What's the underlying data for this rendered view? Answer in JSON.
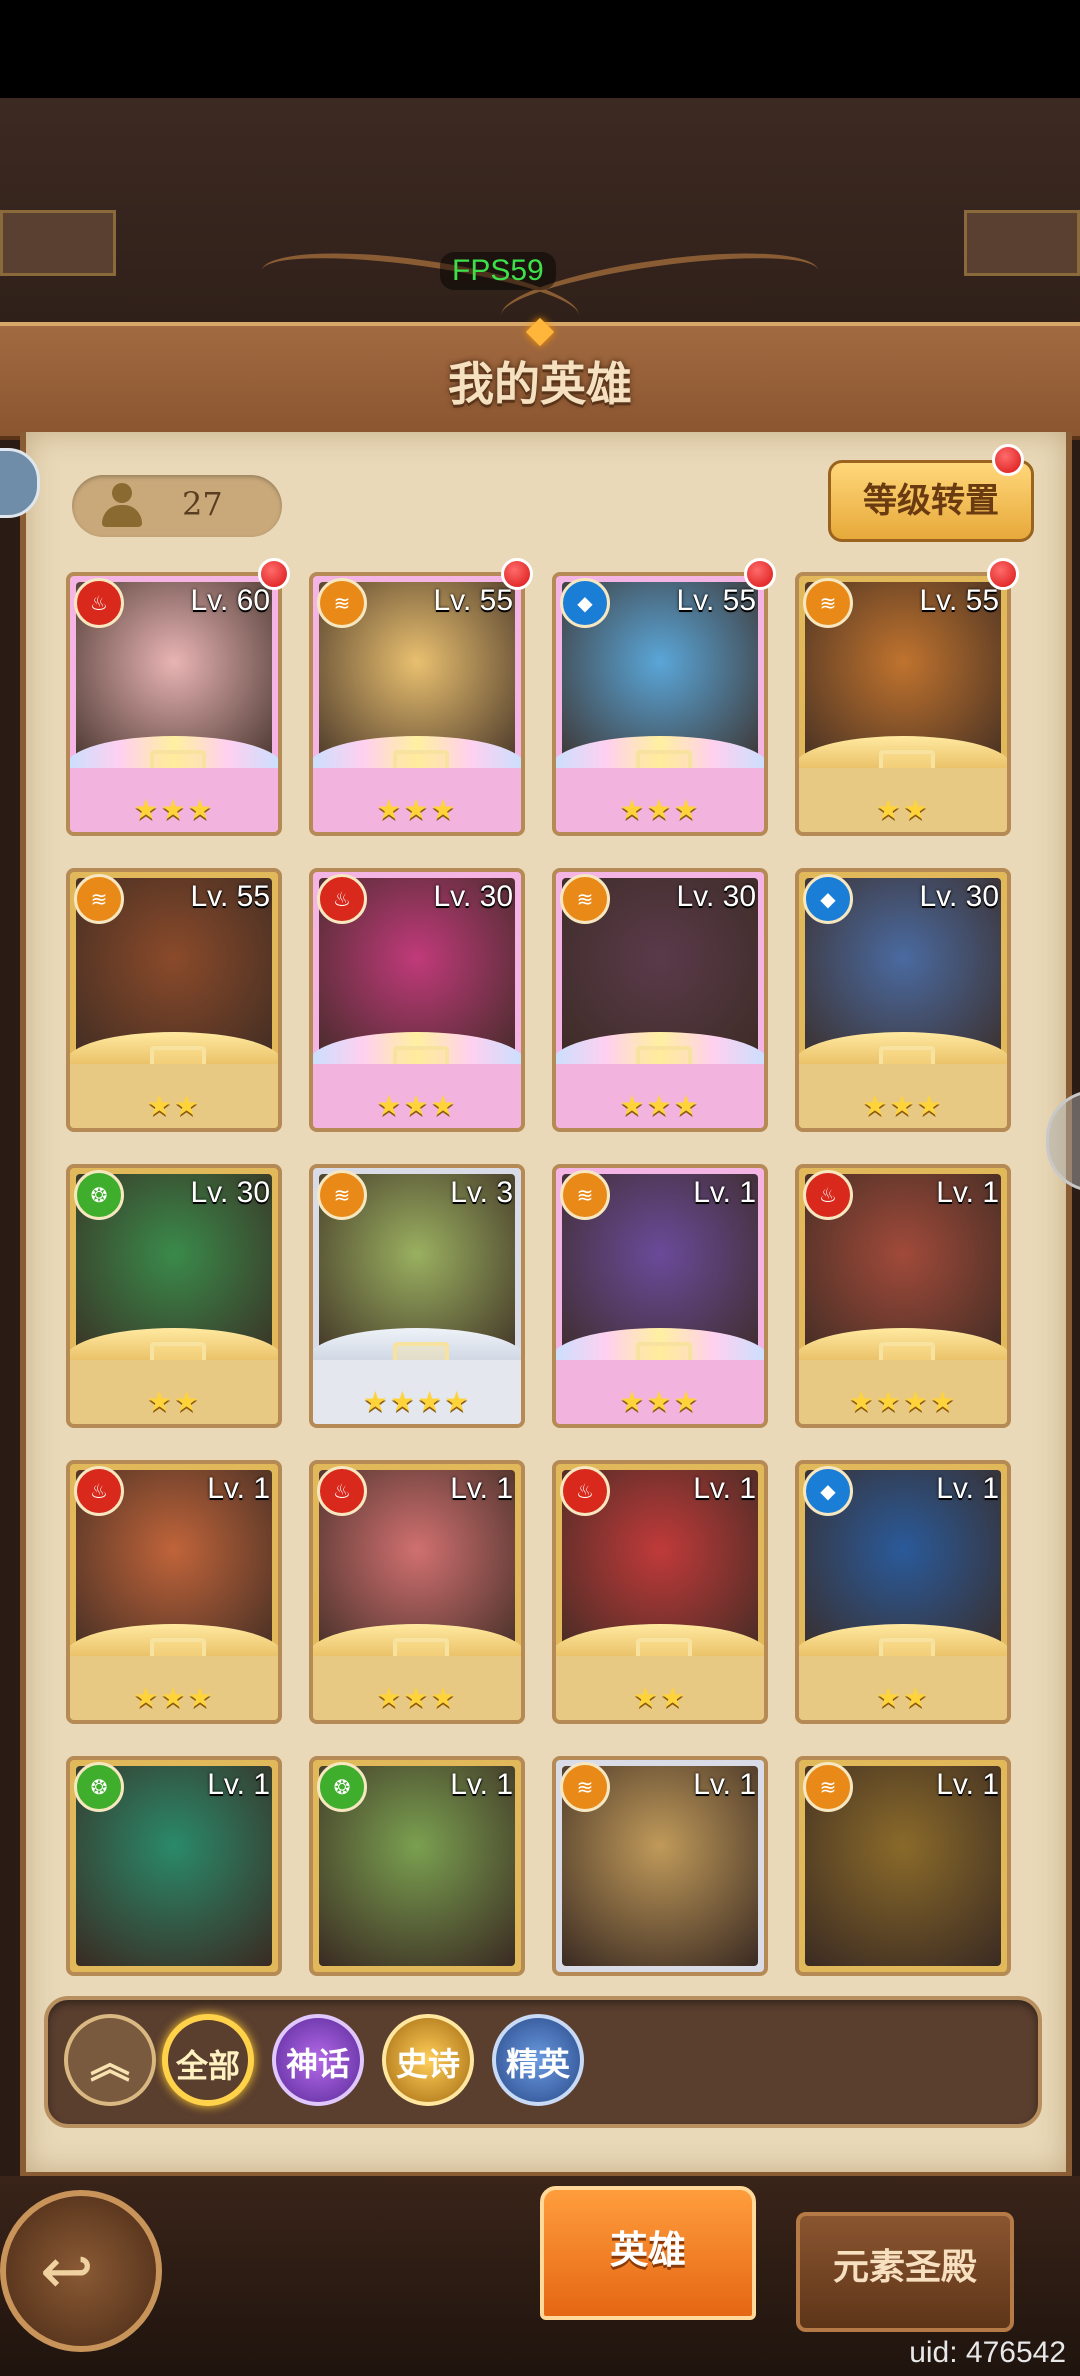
{
  "debug": {
    "fps_label": "FPS59"
  },
  "header": {
    "title": "我的英雄"
  },
  "hero_count": "27",
  "level_transfer_label": "等级转置",
  "colors": {
    "fire": "#d8291c",
    "wind": "#e98a18",
    "water": "#1a7ed6",
    "earth": "#3fae2c",
    "gold_frame": "#e2b95a",
    "myth_frame": "#f4b4e4",
    "accent": "#ffd24a"
  },
  "heroes": [
    {
      "level": "Lv. 60",
      "element": "fire",
      "rarity": "myth",
      "stars": "★★★",
      "new": true,
      "tint": "#e8b4b4"
    },
    {
      "level": "Lv. 55",
      "element": "wind",
      "rarity": "myth",
      "stars": "★★★",
      "new": true,
      "tint": "#e9c070"
    },
    {
      "level": "Lv. 55",
      "element": "water",
      "rarity": "myth",
      "stars": "★★★",
      "new": true,
      "tint": "#5aa6d8"
    },
    {
      "level": "Lv. 55",
      "element": "wind",
      "rarity": "epic",
      "stars": "★★",
      "new": true,
      "tint": "#c0732e"
    },
    {
      "level": "Lv. 55",
      "element": "wind",
      "rarity": "epic",
      "stars": "★★",
      "new": false,
      "tint": "#8a4a2a"
    },
    {
      "level": "Lv. 30",
      "element": "fire",
      "rarity": "myth",
      "stars": "★★★",
      "new": false,
      "tint": "#c03a7a"
    },
    {
      "level": "Lv. 30",
      "element": "wind",
      "rarity": "myth",
      "stars": "★★★",
      "new": false,
      "tint": "#5a3a4a"
    },
    {
      "level": "Lv. 30",
      "element": "water",
      "rarity": "epic",
      "stars": "★★★",
      "new": false,
      "tint": "#4a6aa0"
    },
    {
      "level": "Lv. 30",
      "element": "earth",
      "rarity": "epic",
      "stars": "★★",
      "new": false,
      "tint": "#3a8a4a"
    },
    {
      "level": "Lv. 3",
      "element": "wind",
      "rarity": "elite",
      "stars": "★★★★",
      "new": false,
      "tint": "#9ab060"
    },
    {
      "level": "Lv. 1",
      "element": "wind",
      "rarity": "myth",
      "stars": "★★★",
      "new": false,
      "tint": "#6a4a9a"
    },
    {
      "level": "Lv. 1",
      "element": "fire",
      "rarity": "epic",
      "stars": "★★★★",
      "new": false,
      "tint": "#a04a3a"
    },
    {
      "level": "Lv. 1",
      "element": "fire",
      "rarity": "epic",
      "stars": "★★★",
      "new": false,
      "tint": "#c0643a"
    },
    {
      "level": "Lv. 1",
      "element": "fire",
      "rarity": "epic",
      "stars": "★★★",
      "new": false,
      "tint": "#d07070"
    },
    {
      "level": "Lv. 1",
      "element": "fire",
      "rarity": "epic",
      "stars": "★★",
      "new": false,
      "tint": "#c03a3a"
    },
    {
      "level": "Lv. 1",
      "element": "water",
      "rarity": "epic",
      "stars": "★★",
      "new": false,
      "tint": "#2a5a9a"
    },
    {
      "level": "Lv. 1",
      "element": "earth",
      "rarity": "epic",
      "stars": "",
      "new": false,
      "tint": "#2a8a6a"
    },
    {
      "level": "Lv. 1",
      "element": "earth",
      "rarity": "epic",
      "stars": "",
      "new": false,
      "tint": "#7aa050"
    },
    {
      "level": "Lv. 1",
      "element": "wind",
      "rarity": "elite",
      "stars": "",
      "new": false,
      "tint": "#c09a5a"
    },
    {
      "level": "Lv. 1",
      "element": "wind",
      "rarity": "epic",
      "stars": "",
      "new": false,
      "tint": "#8a6a2a"
    }
  ],
  "filters": {
    "collapse_icon": "︽",
    "all": "全部",
    "myth": "神话",
    "epic": "史诗",
    "elite": "精英"
  },
  "bottom_nav": {
    "back_icon": "↩",
    "hero_tab": "英雄",
    "shrine_tab": "元素圣殿"
  },
  "uid": "uid: 476542"
}
